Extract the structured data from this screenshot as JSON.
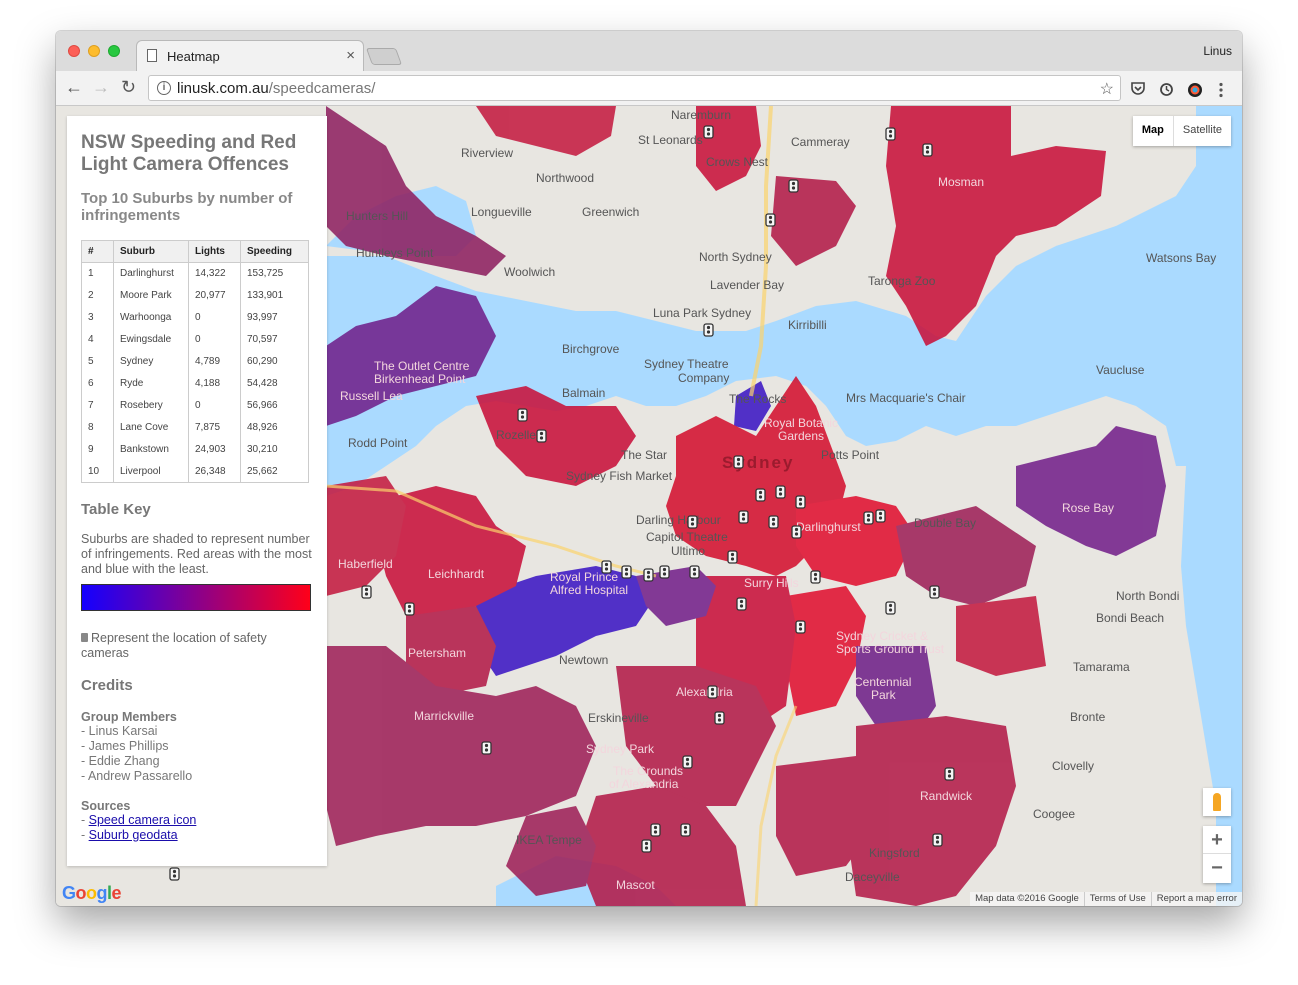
{
  "browser": {
    "tab_title": "Heatmap",
    "tab_close": "×",
    "profile_name": "Linus",
    "url_host": "linusk.com.au",
    "url_path": "/speedcameras/",
    "back": "←",
    "forward": "→",
    "reload": "↻",
    "info": "i",
    "star": "☆"
  },
  "sidebar": {
    "title": "NSW Speeding and Red Light Camera Offences",
    "subtitle": "Top 10 Suburbs by number of infringements",
    "table": {
      "headers": [
        "#",
        "Suburb",
        "Lights",
        "Speeding"
      ],
      "rows": [
        [
          "1",
          "Darlinghurst",
          "14,322",
          "153,725"
        ],
        [
          "2",
          "Moore Park",
          "20,977",
          "133,901"
        ],
        [
          "3",
          "Warhoonga",
          "0",
          "93,997"
        ],
        [
          "4",
          "Ewingsdale",
          "0",
          "70,597"
        ],
        [
          "5",
          "Sydney",
          "4,789",
          "60,290"
        ],
        [
          "6",
          "Ryde",
          "4,188",
          "54,428"
        ],
        [
          "7",
          "Rosebery",
          "0",
          "56,966"
        ],
        [
          "8",
          "Lane Cove",
          "7,875",
          "48,926"
        ],
        [
          "9",
          "Bankstown",
          "24,903",
          "30,210"
        ],
        [
          "10",
          "Liverpool",
          "26,348",
          "25,662"
        ]
      ]
    },
    "key_heading": "Table Key",
    "key_text": "Suburbs are shaded to represent number of infringements. Red areas with the most and blue with the least.",
    "gradient_low": "#1400ff",
    "gradient_high": "#ff0019",
    "camera_note": "Represent the location of safety cameras",
    "credits_heading": "Credits",
    "group_heading": "Group Members",
    "members": [
      "- Linus Karsai",
      "- James Phillips",
      "- Eddie Zhang",
      "- Andrew Passarello"
    ],
    "sources_heading": "Sources",
    "sources": [
      {
        "prefix": "- ",
        "label": "Speed camera icon"
      },
      {
        "prefix": "- ",
        "label": "Suburb geodata"
      }
    ]
  },
  "map": {
    "type_map": "Map",
    "type_satellite": "Satellite",
    "zoom_in": "+",
    "zoom_out": "−",
    "attribution": [
      "Map data ©2016 Google",
      "Terms of Use",
      "Report a map error"
    ],
    "logo": "Google",
    "labels": {
      "naremburn": "Naremburn",
      "st_leonards": "St Leonards",
      "cammeray": "Cammeray",
      "riverview": "Riverview",
      "crows_nest": "Crows Nest",
      "northwood": "Northwood",
      "mosman": "Mosman",
      "hunters_hill": "Hunters Hill",
      "longueville": "Longueville",
      "greenwich": "Greenwich",
      "huntleys_point": "Huntleys Point",
      "woolwich": "Woolwich",
      "north_sydney": "North Sydney",
      "watsons_bay": "Watsons Bay",
      "lavender_bay": "Lavender Bay",
      "taronga_zoo": "Taronga Zoo",
      "luna_park": "Luna Park Sydney",
      "kirribilli": "Kirribilli",
      "birchgrove": "Birchgrove",
      "sydney_theatre": "Sydney Theatre",
      "company": "Company",
      "vaucluse": "Vaucluse",
      "outlet_centre": "The Outlet Centre",
      "birkenhead": "Birkenhead Point",
      "russell_lea": "Russell Lea",
      "balmain": "Balmain",
      "the_rocks": "The Rocks",
      "mrs_macquarie": "Mrs Macquarie's Chair",
      "rozelle": "Rozelle",
      "royal_botanic": "Royal Botanic",
      "gardens": "Gardens",
      "rodd_point": "Rodd Point",
      "the_star": "The Star",
      "sydney": "Sydney",
      "potts_point": "Potts Point",
      "fish_market": "Sydney Fish Market",
      "rose_bay": "Rose Bay",
      "darling_harbour": "Darling Harbour",
      "darlinghurst": "Darlinghurst",
      "double_bay": "Double Bay",
      "capitol_theatre": "Capitol Theatre",
      "haberfield": "Haberfield",
      "leichhardt": "Leichhardt",
      "ultimo": "Ultimo",
      "royal_prince": "Royal Prince",
      "alfred_hospital": "Alfred Hospital",
      "surry_hills": "Surry Hills",
      "north_bondi": "North Bondi",
      "bondi_beach": "Bondi Beach",
      "scg": "Sydney Cricket &",
      "ground_trust": "Sports Ground Trust",
      "petersham": "Petersham",
      "newtown": "Newtown",
      "tamarama": "Tamarama",
      "centennial": "Centennial",
      "park": "Park",
      "alexandria": "Alexandria",
      "erskineville": "Erskineville",
      "bronte": "Bronte",
      "marrickville": "Marrickville",
      "sydney_park": "Sydney Park",
      "clovelly": "Clovelly",
      "grounds": "The Grounds",
      "of_alexandria": "of Alexandria",
      "coogee": "Coogee",
      "randwick": "Randwick",
      "ikea": "IKEA Tempe",
      "kingsford": "Kingsford",
      "mascot": "Mascot",
      "daceyville": "Daceyville"
    }
  },
  "colors": {
    "water": "#aadaff",
    "land": "#e8e6e1",
    "hot": "#d4102f",
    "cold": "#3b16c4"
  }
}
